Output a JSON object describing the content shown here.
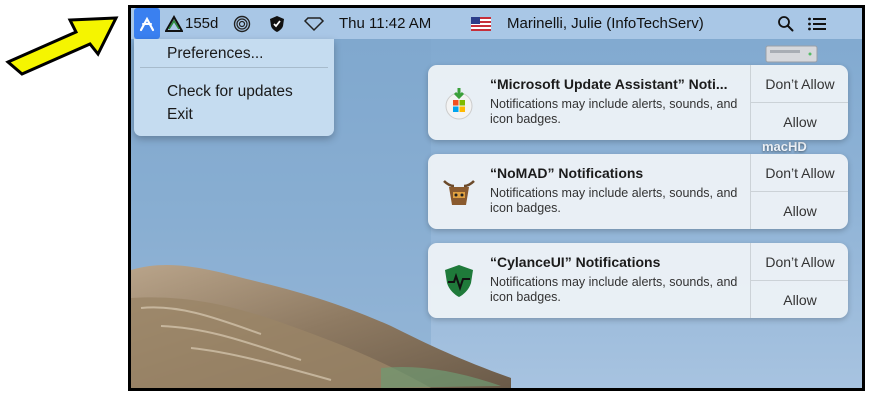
{
  "menubar": {
    "app_icon": "arrow-swirl-icon",
    "status_days": "155d",
    "clock": "Thu 11:42 AM",
    "user": "Marinelli, Julie (InfoTechServ)",
    "flag": "us-flag-icon",
    "icons": [
      "triangle-alert-icon",
      "fingerprint-icon",
      "shield-icon",
      "wifi-diamond-icon",
      "search-icon",
      "list-icon"
    ]
  },
  "dropdown": {
    "items": [
      "Preferences...",
      "Check for updates",
      "Exit"
    ]
  },
  "notifications": [
    {
      "title": "“Microsoft Update Assistant” Noti...",
      "body": "Notifications may include alerts, sounds, and icon badges.",
      "deny": "Don’t Allow",
      "allow": "Allow",
      "icon": "microsoft-update-icon"
    },
    {
      "title": "“NoMAD” Notifications",
      "body": "Notifications may include alerts, sounds, and icon badges.",
      "deny": "Don’t Allow",
      "allow": "Allow",
      "icon": "nomad-icon"
    },
    {
      "title": "“CylanceUI” Notifications",
      "body": "Notifications may include alerts, sounds, and icon badges.",
      "deny": "Don’t Allow",
      "allow": "Allow",
      "icon": "cylance-icon"
    }
  ],
  "desktop": {
    "drive_label": "macHD"
  },
  "colors": {
    "menubar": "#a9c7e6",
    "active_item": "#3a80f0",
    "arrow": "#f5f500"
  }
}
